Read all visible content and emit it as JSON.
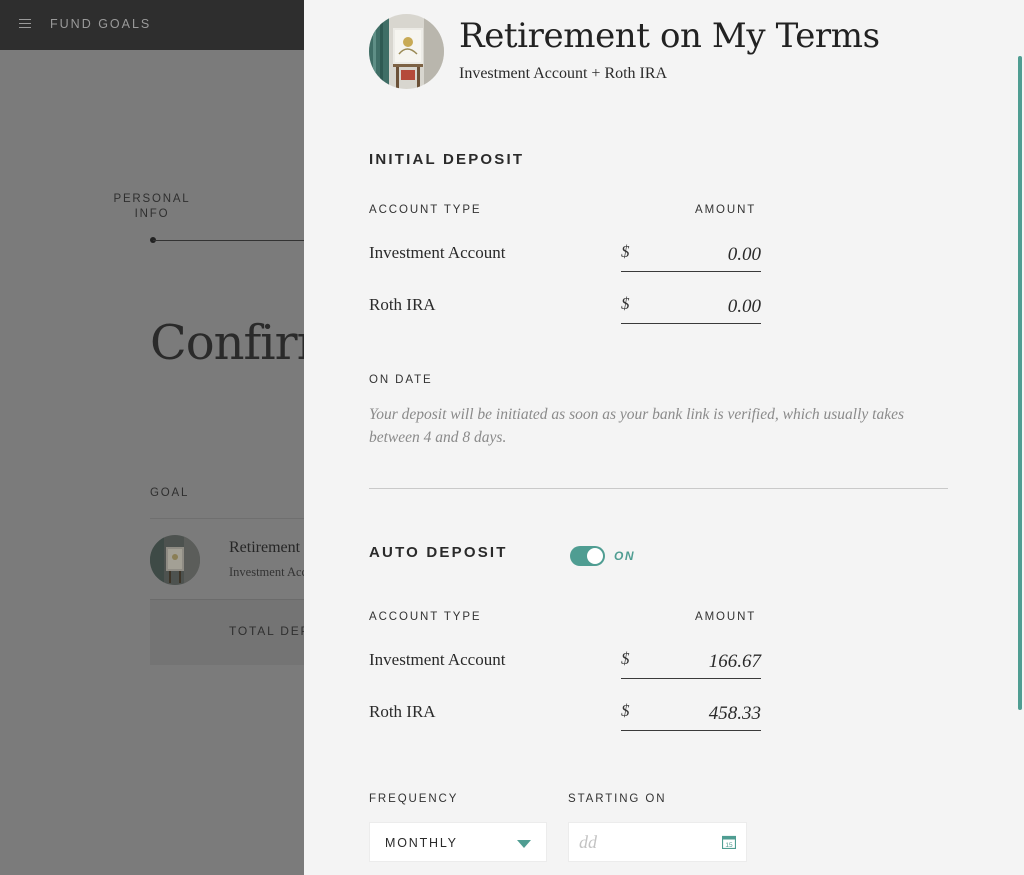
{
  "topbar": {
    "title": "FUND GOALS"
  },
  "background": {
    "step_label": "PERSONAL INFO",
    "heading": "Confirm",
    "goal_column_label": "GOAL",
    "goal_name": "Retirement on My Terms",
    "goal_sub": "Investment Account + Roth IRA",
    "total_label": "TOTAL DEPOSIT"
  },
  "panel": {
    "title": "Retirement on My Terms",
    "subtitle": "Investment Account + Roth IRA",
    "initial_deposit": {
      "title": "INITIAL DEPOSIT",
      "col_account": "ACCOUNT TYPE",
      "col_amount": "AMOUNT",
      "rows": [
        {
          "label": "Investment Account",
          "currency": "$",
          "amount": "0.00"
        },
        {
          "label": "Roth IRA",
          "currency": "$",
          "amount": "0.00"
        }
      ],
      "on_date_label": "ON DATE",
      "note": "Your deposit will be initiated as soon as your bank link is verified, which usually takes between 4 and 8 days."
    },
    "auto_deposit": {
      "title": "AUTO DEPOSIT",
      "toggle_state": "ON",
      "col_account": "ACCOUNT TYPE",
      "col_amount": "AMOUNT",
      "rows": [
        {
          "label": "Investment Account",
          "currency": "$",
          "amount": "166.67"
        },
        {
          "label": "Roth IRA",
          "currency": "$",
          "amount": "458.33"
        }
      ],
      "frequency_label": "FREQUENCY",
      "frequency_value": "MONTHLY",
      "starting_label": "STARTING ON",
      "starting_placeholder": "dd",
      "calendar_day": "15"
    }
  },
  "colors": {
    "accent": "#4f9d92",
    "panel_bg": "#f4f4f4",
    "overlay": "#7b7b7b",
    "topbar": "#2e2e2e"
  }
}
